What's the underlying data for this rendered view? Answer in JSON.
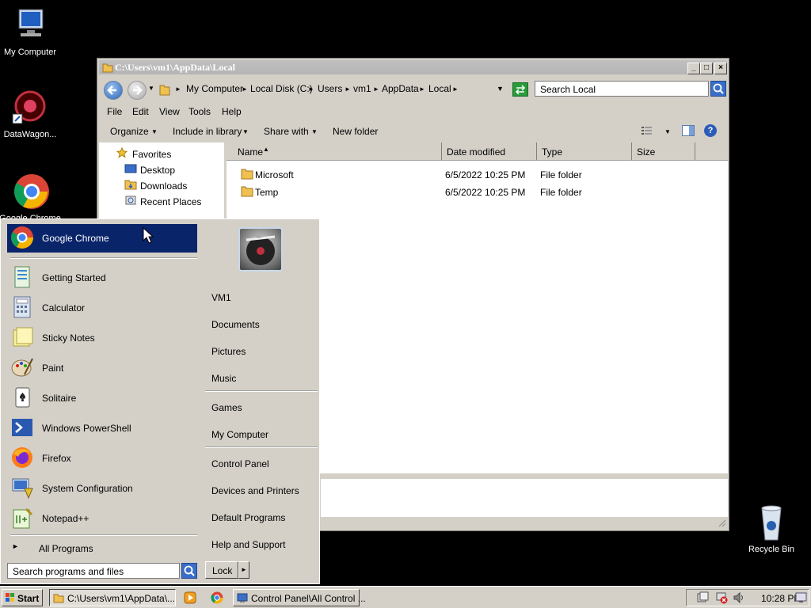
{
  "desktop": {
    "icons": [
      {
        "label": "My Computer"
      },
      {
        "label": "DataWagon..."
      },
      {
        "label": "Google Chrome"
      },
      {
        "label": "Recycle Bin"
      }
    ]
  },
  "explorer": {
    "title": "C:\\Users\\vm1\\AppData\\Local",
    "breadcrumb": [
      "My Computer",
      "Local Disk (C:)",
      "Users",
      "vm1",
      "AppData",
      "Local"
    ],
    "search_placeholder": "Search Local",
    "menu": [
      "File",
      "Edit",
      "View",
      "Tools",
      "Help"
    ],
    "toolbar": {
      "organize": "Organize",
      "include": "Include in library",
      "share": "Share with",
      "new_folder": "New folder"
    },
    "nav": {
      "favorites": "Favorites",
      "items": [
        "Desktop",
        "Downloads",
        "Recent Places"
      ]
    },
    "columns": [
      "Name",
      "Date modified",
      "Type",
      "Size"
    ],
    "files": [
      {
        "name": "Microsoft",
        "date": "6/5/2022 10:25 PM",
        "type": "File folder"
      },
      {
        "name": "Temp",
        "date": "6/5/2022 10:25 PM",
        "type": "File folder"
      }
    ]
  },
  "start_menu": {
    "pinned": "Google Chrome",
    "programs": [
      "Getting Started",
      "Calculator",
      "Sticky Notes",
      "Paint",
      "Solitaire",
      "Windows PowerShell",
      "Firefox",
      "System Configuration",
      "Notepad++"
    ],
    "all_programs": "All Programs",
    "search_placeholder": "Search programs and files",
    "right_group1": [
      "VM1",
      "Documents",
      "Pictures",
      "Music"
    ],
    "right_group2": [
      "Games",
      "My Computer"
    ],
    "right_group3": [
      "Control Panel",
      "Devices and Printers",
      "Default Programs",
      "Help and Support"
    ],
    "lock": "Lock"
  },
  "taskbar": {
    "start": "Start",
    "tasks": [
      "C:\\Users\\vm1\\AppData\\...",
      "Control Panel\\All Control ..."
    ],
    "clock": "10:28 PM"
  },
  "colors": {
    "selection": "#0a246a",
    "window_face": "#d4d0c8",
    "desktop": "#000000"
  }
}
